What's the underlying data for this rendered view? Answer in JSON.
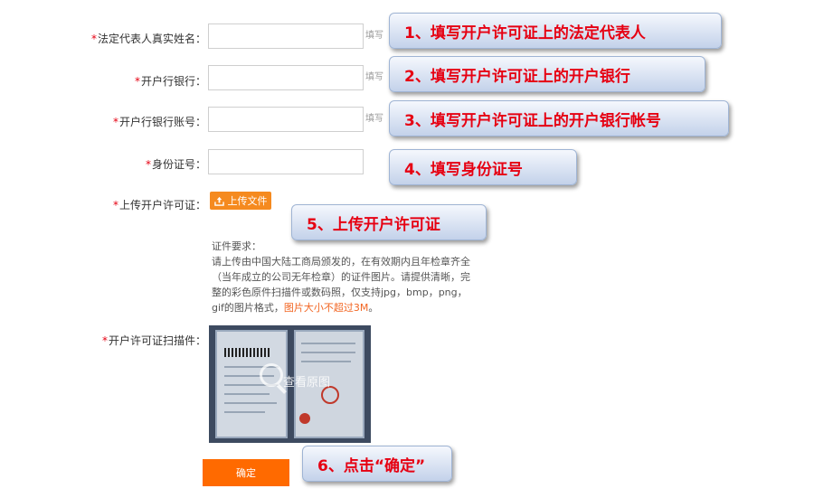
{
  "form": {
    "rep_name_label": "法定代表人真实姓名：",
    "bank_label": "开户行银行：",
    "account_label": "开户行银行账号：",
    "id_label": "身份证号：",
    "upload_label": "上传开户许可证：",
    "scan_label": "开户许可证扫描件：",
    "required_mark": "*",
    "field_hint": "填写",
    "upload_button": "上传文件",
    "requirements_title": "证件要求：",
    "requirements_body": "请上传由中国大陆工商局颁发的，在有效期内且年检章齐全（当年成立的公司无年检章）的证件图片。请提供清晰，完整的彩色原件扫描件或数码照，仅支持jpg，bmp，png，gif的图片格式，",
    "requirements_warn": "图片大小不超过3M",
    "requirements_end": "。",
    "view_original": "查看原图",
    "confirm_button": "确定"
  },
  "callouts": {
    "c1": "1、填写开户许可证上的法定代表人",
    "c2": "2、填写开户许可证上的开户银行",
    "c3": "3、填写开户许可证上的开户银行帐号",
    "c4": "4、填写身份证号",
    "c5": "5、上传开户许可证",
    "c6": "6、点击“确定”"
  },
  "colors": {
    "required": "#e60012",
    "accent": "#ff6a00",
    "callout_text": "#e60012"
  }
}
